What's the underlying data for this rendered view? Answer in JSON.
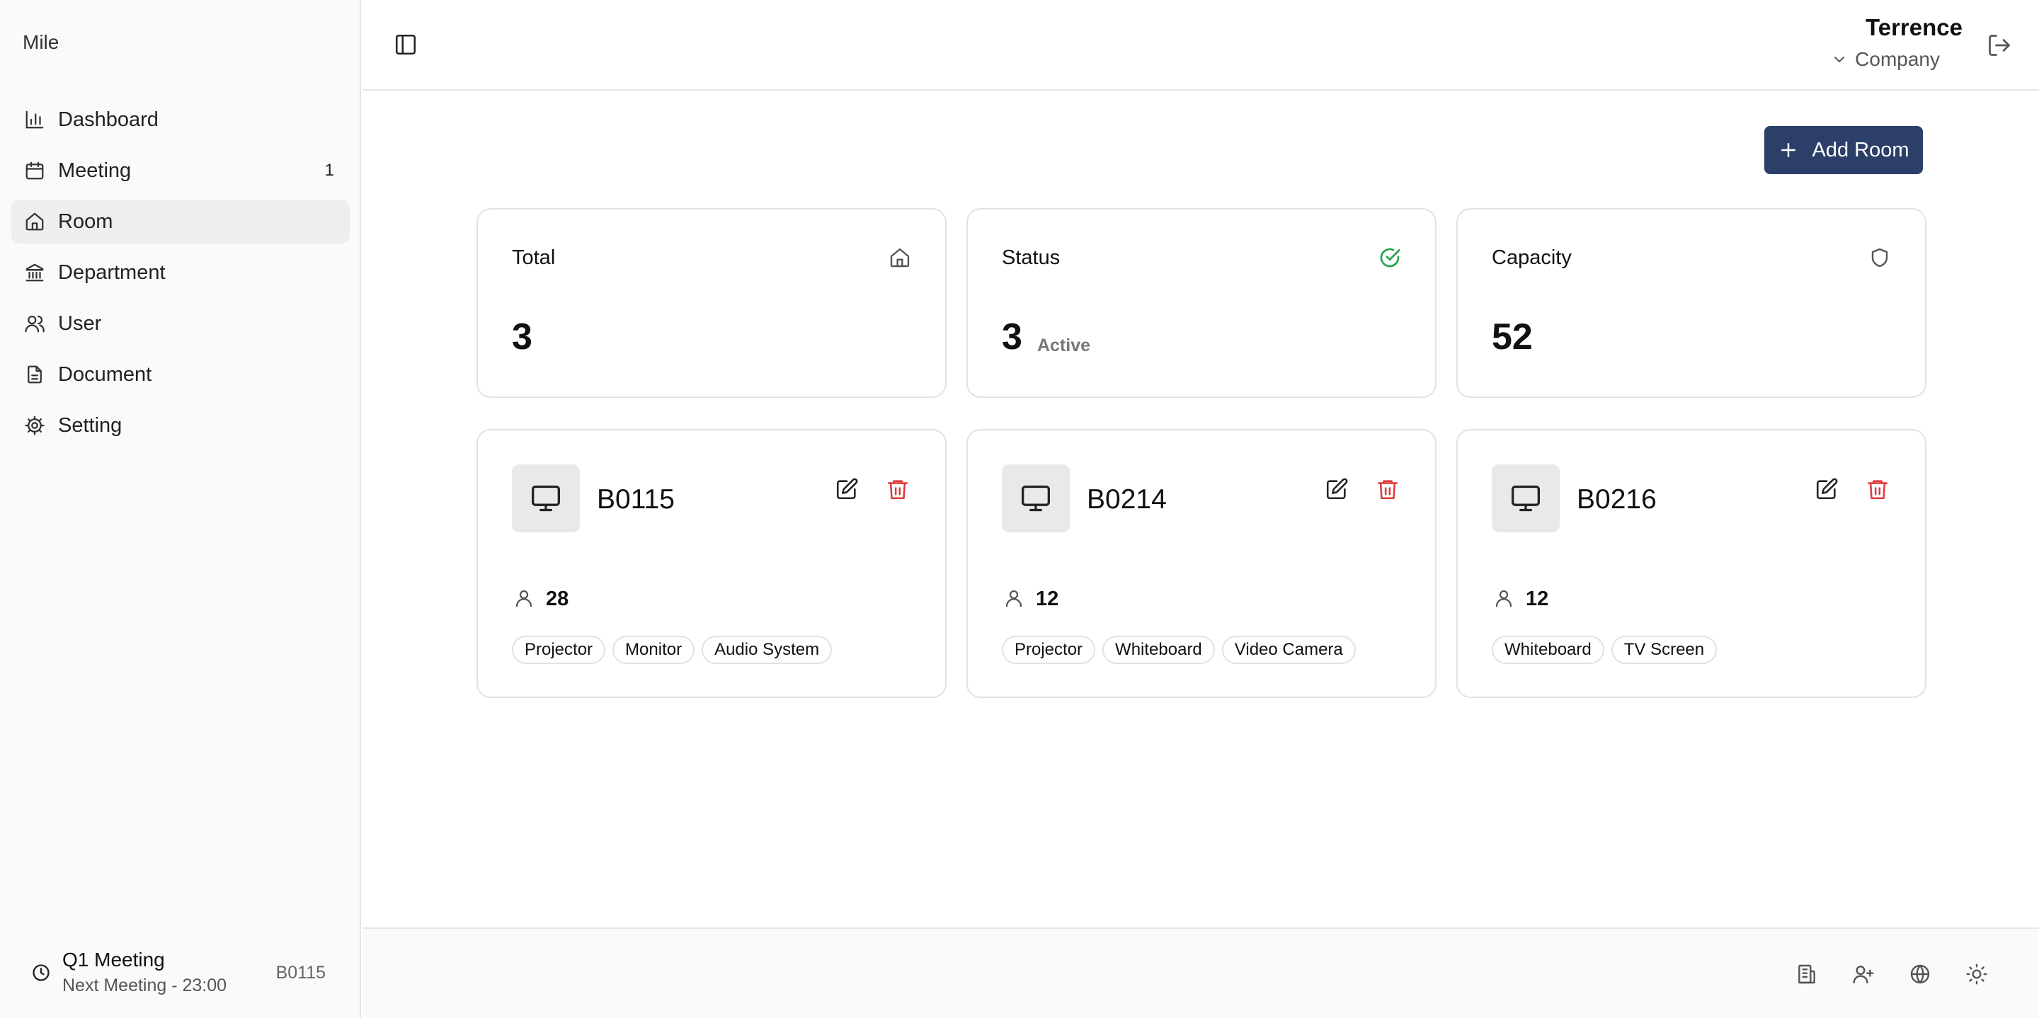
{
  "brand": "Mile",
  "sidebar": {
    "items": [
      {
        "label": "Dashboard",
        "icon": "chart-icon"
      },
      {
        "label": "Meeting",
        "icon": "calendar-icon",
        "badge": "1"
      },
      {
        "label": "Room",
        "icon": "home-icon",
        "active": true
      },
      {
        "label": "Department",
        "icon": "building-icon"
      },
      {
        "label": "User",
        "icon": "users-icon"
      },
      {
        "label": "Document",
        "icon": "document-icon"
      },
      {
        "label": "Setting",
        "icon": "gear-icon"
      }
    ],
    "next_meeting": {
      "title": "Q1 Meeting",
      "subtitle": "Next Meeting - 23:00",
      "room": "B0115"
    }
  },
  "header": {
    "user_name": "Terrence",
    "company": "Company"
  },
  "toolbar": {
    "add_room_label": "Add Room"
  },
  "stats": {
    "total": {
      "title": "Total",
      "value": "3",
      "icon": "home-icon"
    },
    "status": {
      "title": "Status",
      "value": "3",
      "unit": "Active",
      "icon": "check-circle-icon",
      "icon_color": "#22a34a"
    },
    "capacity": {
      "title": "Capacity",
      "value": "52",
      "icon": "shield-icon"
    }
  },
  "rooms": [
    {
      "name": "B0115",
      "capacity": "28",
      "tags": [
        "Projector",
        "Monitor",
        "Audio System"
      ]
    },
    {
      "name": "B0214",
      "capacity": "12",
      "tags": [
        "Projector",
        "Whiteboard",
        "Video Camera"
      ]
    },
    {
      "name": "B0216",
      "capacity": "12",
      "tags": [
        "Whiteboard",
        "TV Screen"
      ]
    }
  ],
  "colors": {
    "primary": "#2b3f68",
    "danger": "#dc3a3a",
    "success": "#22a34a"
  }
}
